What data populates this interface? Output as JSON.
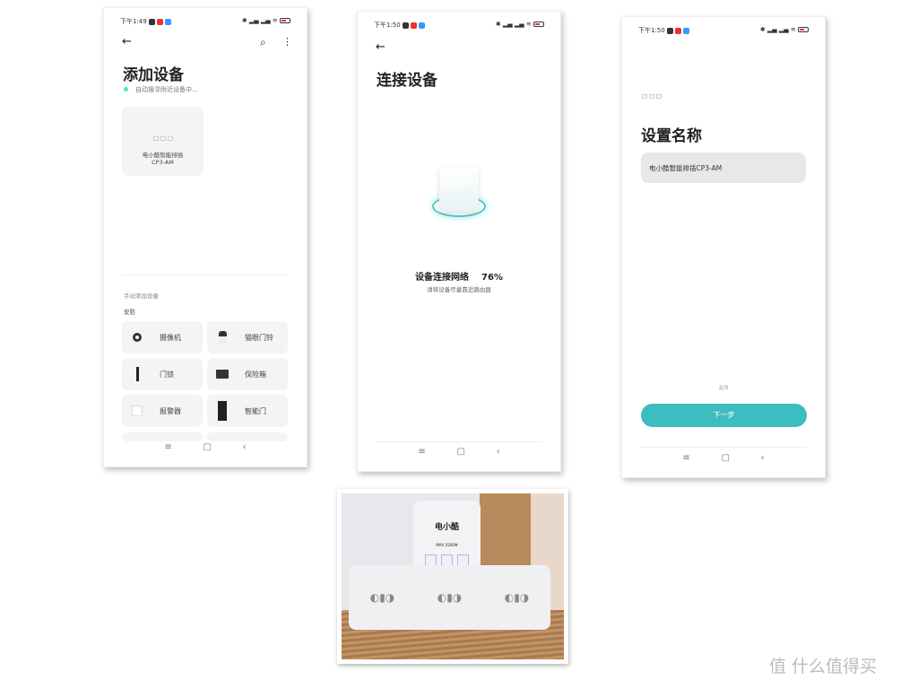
{
  "screen1": {
    "time": "下午1:49",
    "title": "添加设备",
    "scanning": "自动搜寻附近设备中...",
    "found_device": {
      "name_line1": "电小酷智能排插",
      "name_line2": "CP3-AM"
    },
    "manual_label": "手动添加设备",
    "category": "安防",
    "devices": [
      {
        "label": "摄像机",
        "icon": "camera-icon"
      },
      {
        "label": "猫眼门铃",
        "icon": "doorbell-icon"
      },
      {
        "label": "门锁",
        "icon": "door-lock-icon"
      },
      {
        "label": "保险箱",
        "icon": "safe-icon"
      },
      {
        "label": "报警器",
        "icon": "alarm-icon"
      },
      {
        "label": "智能门",
        "icon": "smart-door-icon"
      }
    ]
  },
  "screen2": {
    "time": "下午1:50",
    "title": "连接设备",
    "status": "设备连接网络",
    "progress_text": "76%",
    "progress": 76,
    "hint": "请将设备尽量靠近路由器"
  },
  "screen3": {
    "time": "下午1:50",
    "title": "设置名称",
    "name_value": "电小酷智能排插CP3-AM",
    "step": "2/3",
    "next_label": "下一步",
    "accent": "#3dbdbf"
  },
  "photo": {
    "brand": "电小酷",
    "rating": "MAX 2500W"
  },
  "watermark": "值 什么值得买"
}
